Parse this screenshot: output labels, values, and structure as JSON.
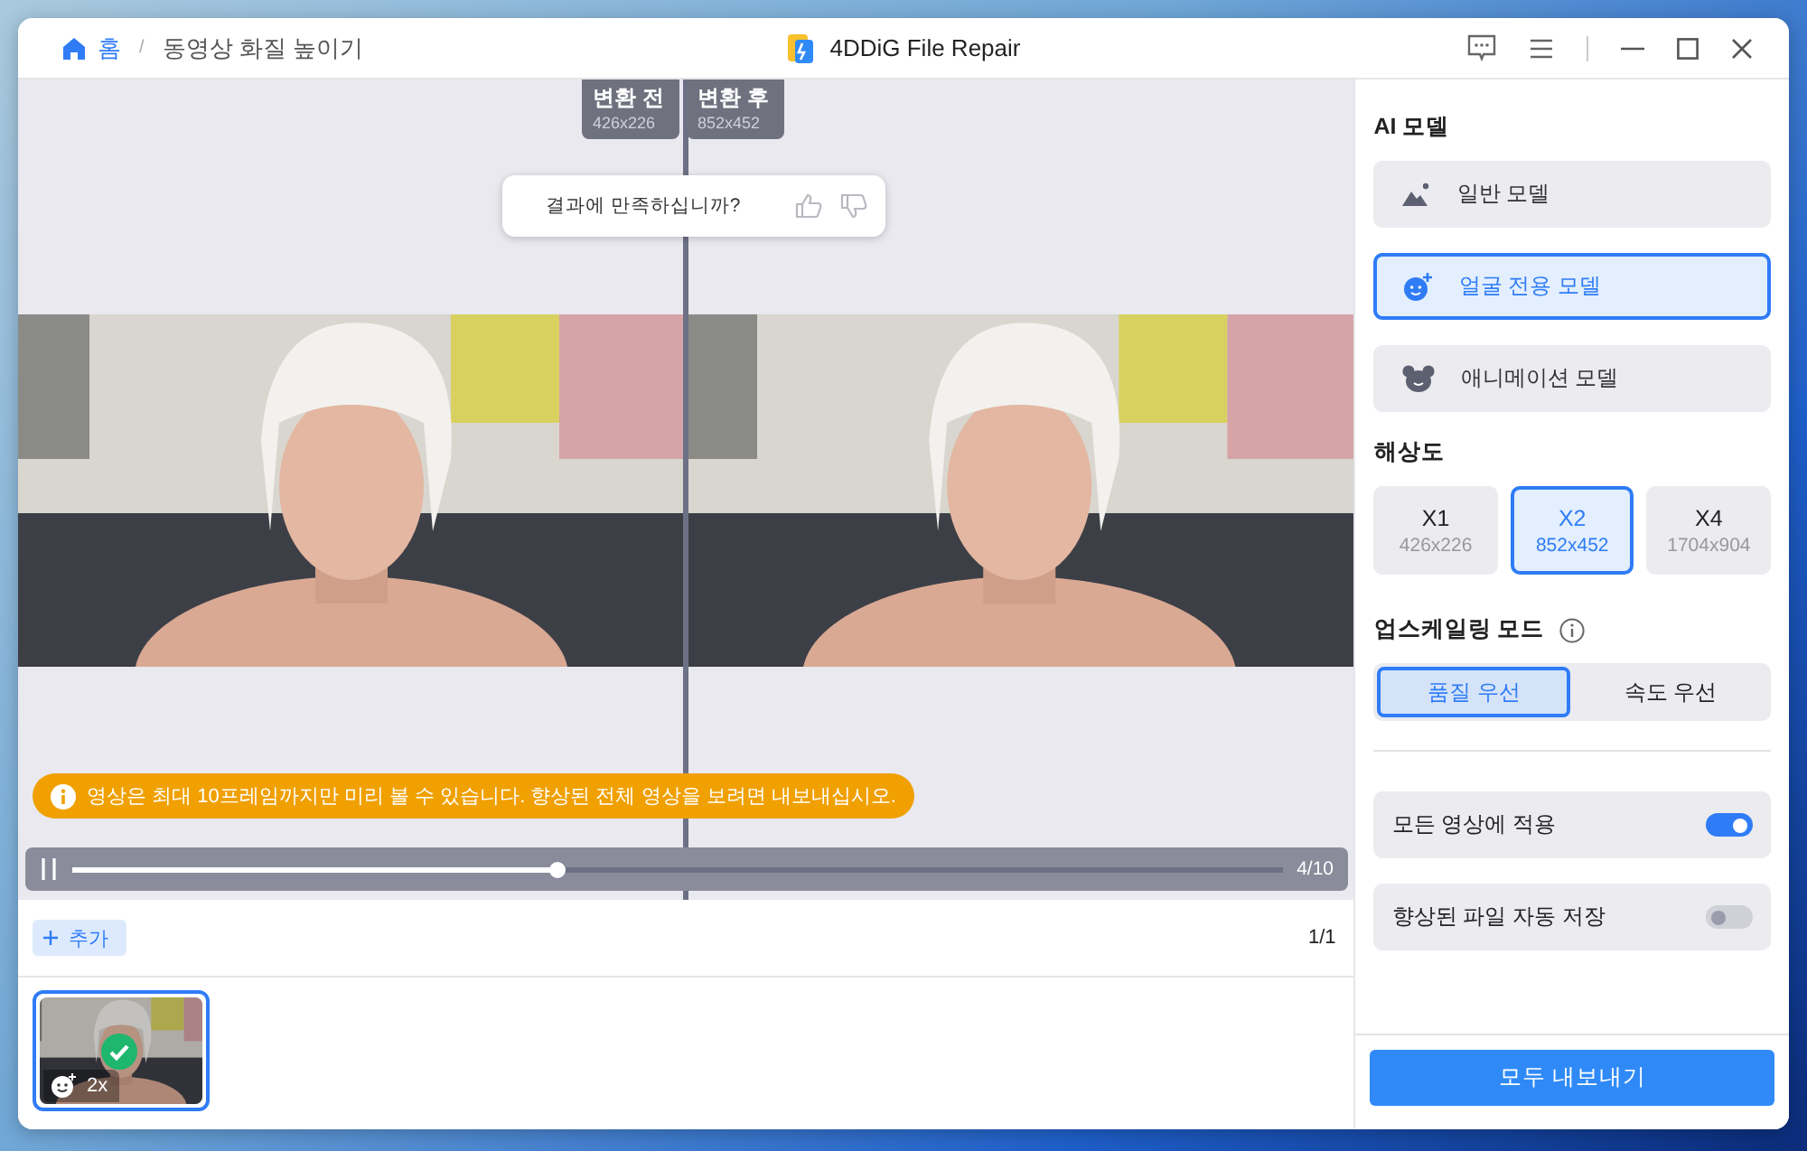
{
  "window": {
    "title": "4DDiG File Repair"
  },
  "breadcrumb": {
    "home": "홈",
    "separator": "/",
    "current": "동영상 화질 높이기"
  },
  "preview": {
    "before": {
      "label": "변환 전",
      "size": "426x226"
    },
    "after": {
      "label": "변환 후",
      "size": "852x452"
    },
    "feedback": "결과에 만족하십니까?",
    "notice": "영상은 최대 10프레임까지만 미리 볼 수 있습니다. 향상된 전체 영상을 보려면 내보내십시오.",
    "playback": {
      "level": 0.4,
      "frame": "4/10"
    }
  },
  "files": {
    "add_button": "추가",
    "page": "1/1",
    "thumbnails": [
      {
        "badge": "2x",
        "selected": true,
        "done": true
      }
    ]
  },
  "settings": {
    "ai_model_title": "AI 모델",
    "models": [
      {
        "label": "일반 모델",
        "kind": "general",
        "selected": false
      },
      {
        "label": "얼굴 전용 모델",
        "kind": "face",
        "selected": true
      },
      {
        "label": "애니메이션 모델",
        "kind": "animation",
        "selected": false
      }
    ],
    "resolution_title": "해상도",
    "resolutions": [
      {
        "label": "X1",
        "size": "426x226",
        "selected": false
      },
      {
        "label": "X2",
        "size": "852x452",
        "selected": true
      },
      {
        "label": "X4",
        "size": "1704x904",
        "selected": false
      }
    ],
    "mode_title": "업스케일링 모드",
    "modes": [
      {
        "label": "품질 우선",
        "selected": true
      },
      {
        "label": "속도 우선",
        "selected": false
      }
    ],
    "toggles": [
      {
        "label": "모든 영상에 적용",
        "on": true
      },
      {
        "label": "향상된 파일 자동 저장",
        "on": false
      }
    ],
    "export_button": "모두 내보내기"
  }
}
